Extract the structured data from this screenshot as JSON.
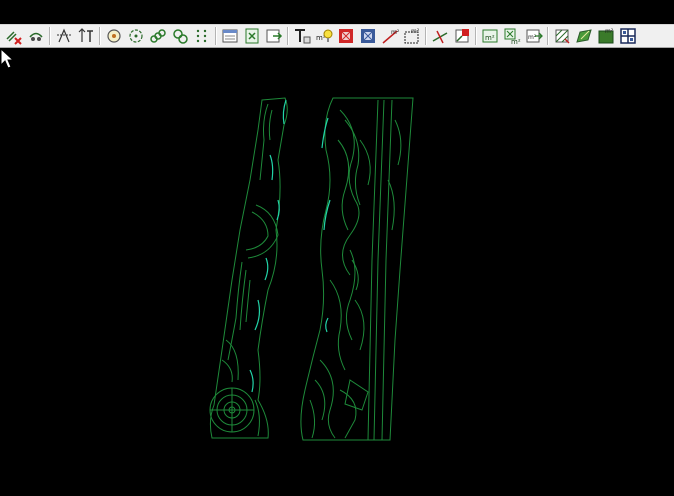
{
  "toolbar": {
    "groups": [
      [
        "erase-red-x-icon",
        "redraw-objects-icon"
      ],
      [
        "align-arrows-icon",
        "text-height-icon"
      ],
      [
        "circle-target-icon",
        "circle-dashed-icon",
        "chain-links-icon",
        "link-shape-icon",
        "dot-grid-icon"
      ],
      [
        "table-window-icon",
        "excel-sheet-icon",
        "export-sheet-icon"
      ],
      [
        "text-style-icon",
        "area-bulb-icon",
        "red-frame-icon",
        "blue-frame-icon",
        "area-line-icon",
        "area-dashed-box-icon"
      ],
      [
        "cut-line-icon",
        "cross-red-icon"
      ],
      [
        "m2-table-icon",
        "m2-excel-icon",
        "m2-export-icon"
      ],
      [
        "pattern-fill-icon",
        "green-edit-icon",
        "hatch-fill-icon",
        "grid-blocks-icon"
      ]
    ]
  },
  "colors": {
    "toolbar_bg": "#f0f0f0",
    "canvas_bg": "#000000",
    "drawing_line": "#1e8a3a",
    "highlight_line": "#22d4a8"
  },
  "texts": {
    "m2": "m²",
    "T": "T"
  }
}
